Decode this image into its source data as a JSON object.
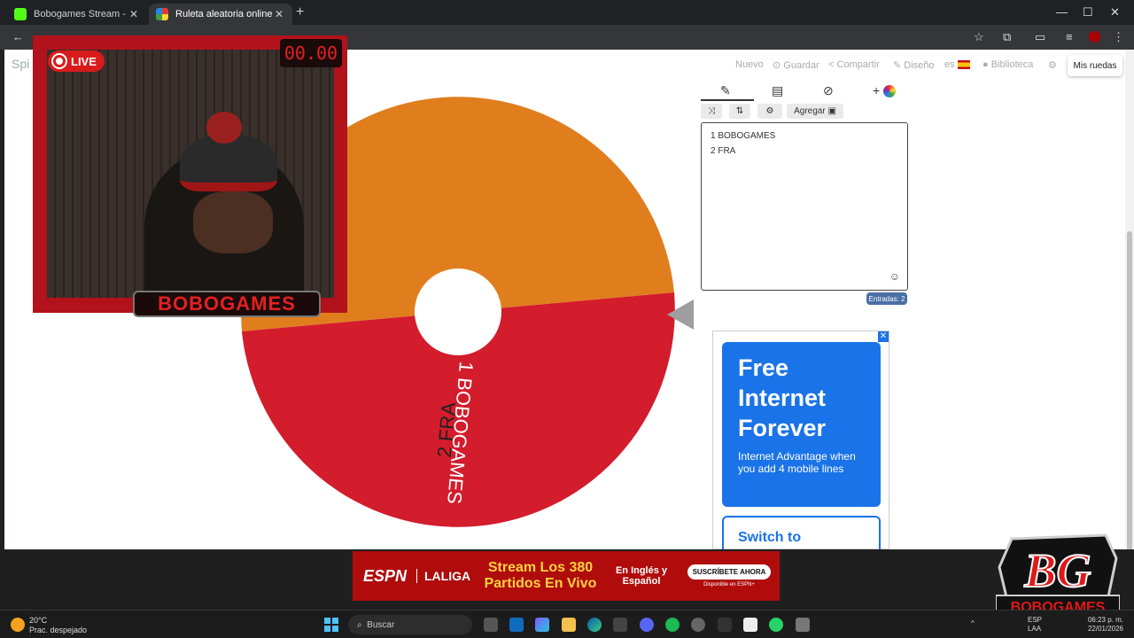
{
  "browser": {
    "tabs": [
      {
        "title": "Bobogames Stream - Watch Li",
        "close": "✕"
      },
      {
        "title": "Ruleta aleatoria online – ruleta",
        "close": "✕"
      }
    ],
    "new_tab": "+",
    "window_controls": {
      "minimize": "—",
      "maximize": "☐",
      "close": "✕"
    }
  },
  "site": {
    "logo": "Spi",
    "nav": {
      "nuevo": "Nuevo",
      "guardar": "Guardar",
      "compartir": "Compartir",
      "diseno": "Diseño",
      "lang": "es",
      "biblioteca": "Biblioteca"
    },
    "mis_ruedas": "Mis ruedas"
  },
  "wheel": {
    "segments": [
      {
        "label": "2 FRA",
        "color": "#e07e1e"
      },
      {
        "label": "1 BOBOGAMES",
        "color": "#d31c2c"
      }
    ]
  },
  "editor": {
    "tabs": [
      "edit-icon",
      "clipboard-icon",
      "hide-icon",
      "add-color-icon"
    ],
    "agregar_label": "Agregar",
    "entries": [
      "1 BOBOGAMES",
      "2 FRA"
    ],
    "count_label": "Entradas: 2"
  },
  "ad": {
    "headline": [
      "Free",
      "Internet",
      "Forever"
    ],
    "body": "Internet Advantage when you add 4 mobile lines",
    "switch": "Switch to"
  },
  "stream_overlay": {
    "live": "LIVE",
    "timer": "00.00",
    "name": "BOBOGAMES",
    "logo": "BG",
    "logo_sub": "BOBOGAMES"
  },
  "banner_ad": {
    "brand": "ESPN",
    "league": "LALIGA",
    "headline": "Stream Los 380 Partidos En Vivo",
    "langs": "En Inglés y Español",
    "cta": "SUSCRÍBETE AHORA",
    "cta_sub": "Disponible en ESPN+"
  },
  "taskbar": {
    "temp": "20°C",
    "weather": "Prac. despejado",
    "search": "Buscar",
    "lang_top": "ESP",
    "lang_bottom": "LAA",
    "time": "06:23 p. m.",
    "date": "22/01/2026"
  }
}
